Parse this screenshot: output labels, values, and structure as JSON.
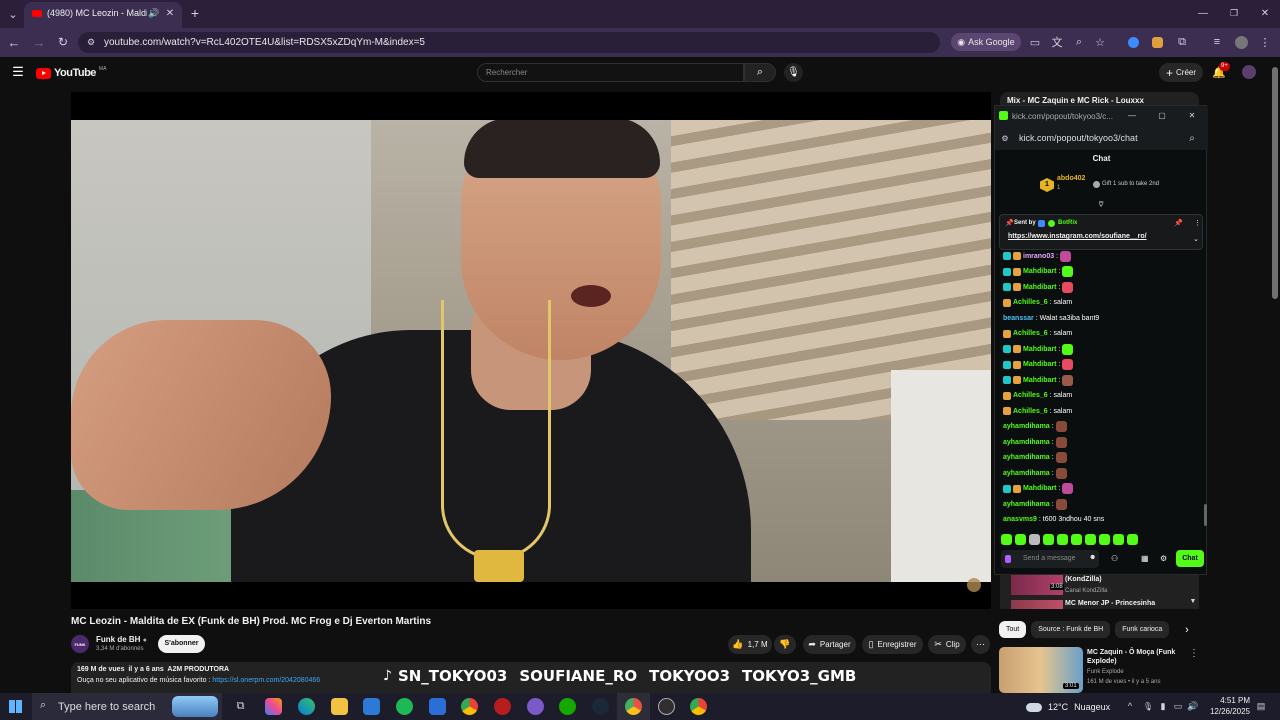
{
  "browser": {
    "tab_title": "(4980) MC Leozin - Maldita",
    "new_tab": "+",
    "url": "youtube.com/watch?v=RcL402OTE4U&list=RDSX5xZDqYm-M&index=5",
    "ask_google": "Ask Google"
  },
  "youtube": {
    "logo": "YouTube",
    "logo_region": "MA",
    "search_placeholder": "Rechercher",
    "create_label": "Créer",
    "notif_count": "9+",
    "video_title": "MC Leozin - Maldita de EX (Funk de BH) Prod. MC Frog e Dj Everton Martins",
    "channel_name": "Funk de BH",
    "channel_avatar_text": "FUNK",
    "subscribers": "3,34 M d'abonnés",
    "subscribe_label": "S'abonner",
    "likes": "1,7 M",
    "share_label": "Partager",
    "save_label": "Enregistrer",
    "clip_label": "Clip",
    "views_line": "169 M de vues  il y a 6 ans  A2M PRODUTORA",
    "desc_line": "Ouça no seu aplicativo de música favorito : ",
    "desc_link": "https://sl.onerpm.com/2042080466",
    "side_top_title": "Mix - MC Zaquin e MC Rick - Louxxx",
    "side_item1_title": "(KondZilla)",
    "side_item1_channel": "Canal KondZilla",
    "side_item1_duration": "3:08",
    "side_item2_title": "MC Menor JP - Princesinha",
    "chips": [
      "Tout",
      "Source : Funk de BH",
      "Funk carioca"
    ],
    "rec_title": "MC Zaquin - Ô Moça (Funk Explode)",
    "rec_channel": "Funk Explode",
    "rec_meta": "161 M de vues • il y a 5 ans",
    "rec_duration": "3:01"
  },
  "kick": {
    "window_title": "kick.com/popout/tokyoo3/c...",
    "url": "kick.com/popout/tokyoo3/chat",
    "header": "Chat",
    "gifter_name": "abdo402",
    "gifter_count": "1",
    "gift_text": "Gift 1 sub to take 2nd",
    "rank": "1",
    "pinned_sent_by": "Sent by",
    "pinned_bot": "BotRix",
    "pinned_link": "https://www.instagram.com/soufiane__ro/",
    "messages": [
      {
        "user": "imrano03",
        "text": ":",
        "color": "#e6a7ff"
      },
      {
        "user": "Mahdibart",
        "text": ":",
        "color": "#53fc18"
      },
      {
        "user": "Mahdibart",
        "text": ":",
        "color": "#53fc18"
      },
      {
        "user": "Achilles_6",
        "text": ": salam",
        "color": "#53fc18"
      },
      {
        "user": "beanssar",
        "text": ": Walat sa3iba bant9",
        "color": "#4fc3f7"
      },
      {
        "user": "Achilles_6",
        "text": ": salam",
        "color": "#53fc18"
      },
      {
        "user": "Mahdibart",
        "text": ":",
        "color": "#53fc18"
      },
      {
        "user": "Mahdibart",
        "text": ":",
        "color": "#53fc18"
      },
      {
        "user": "Mahdibart",
        "text": ":",
        "color": "#53fc18"
      },
      {
        "user": "Achilles_6",
        "text": ": salam",
        "color": "#53fc18"
      },
      {
        "user": "Achilles_6",
        "text": ": salam",
        "color": "#53fc18"
      },
      {
        "user": "ayhamdihama",
        "text": ":",
        "color": "#53fc18"
      },
      {
        "user": "ayhamdihama",
        "text": ":",
        "color": "#53fc18"
      },
      {
        "user": "ayhamdihama",
        "text": ":",
        "color": "#53fc18"
      },
      {
        "user": "ayhamdihama",
        "text": ":",
        "color": "#53fc18"
      },
      {
        "user": "Mahdibart",
        "text": ":",
        "color": "#53fc18"
      },
      {
        "user": "ayhamdihama",
        "text": ":",
        "color": "#53fc18"
      },
      {
        "user": "anasvms9",
        "text": ": t600 3ndhou 40 sns",
        "color": "#53fc18"
      }
    ],
    "input_placeholder": "Send a message",
    "chat_button": "Chat"
  },
  "overlay": {
    "tiktok": "SN_TOKYO03",
    "instagram": "SOUFIANE_RO",
    "kick": "TOKYOO3",
    "telegram": "TOKYO3_GMB"
  },
  "taskbar": {
    "search_placeholder": "Type here to search",
    "weather_temp": "12°C",
    "weather_text": "Nuageux",
    "time": "4:51 PM",
    "date": "12/26/2025"
  },
  "colors": {
    "kick_green": "#53fc18",
    "yt_red": "#ff0000",
    "chrome_purple": "#3c2e50"
  }
}
